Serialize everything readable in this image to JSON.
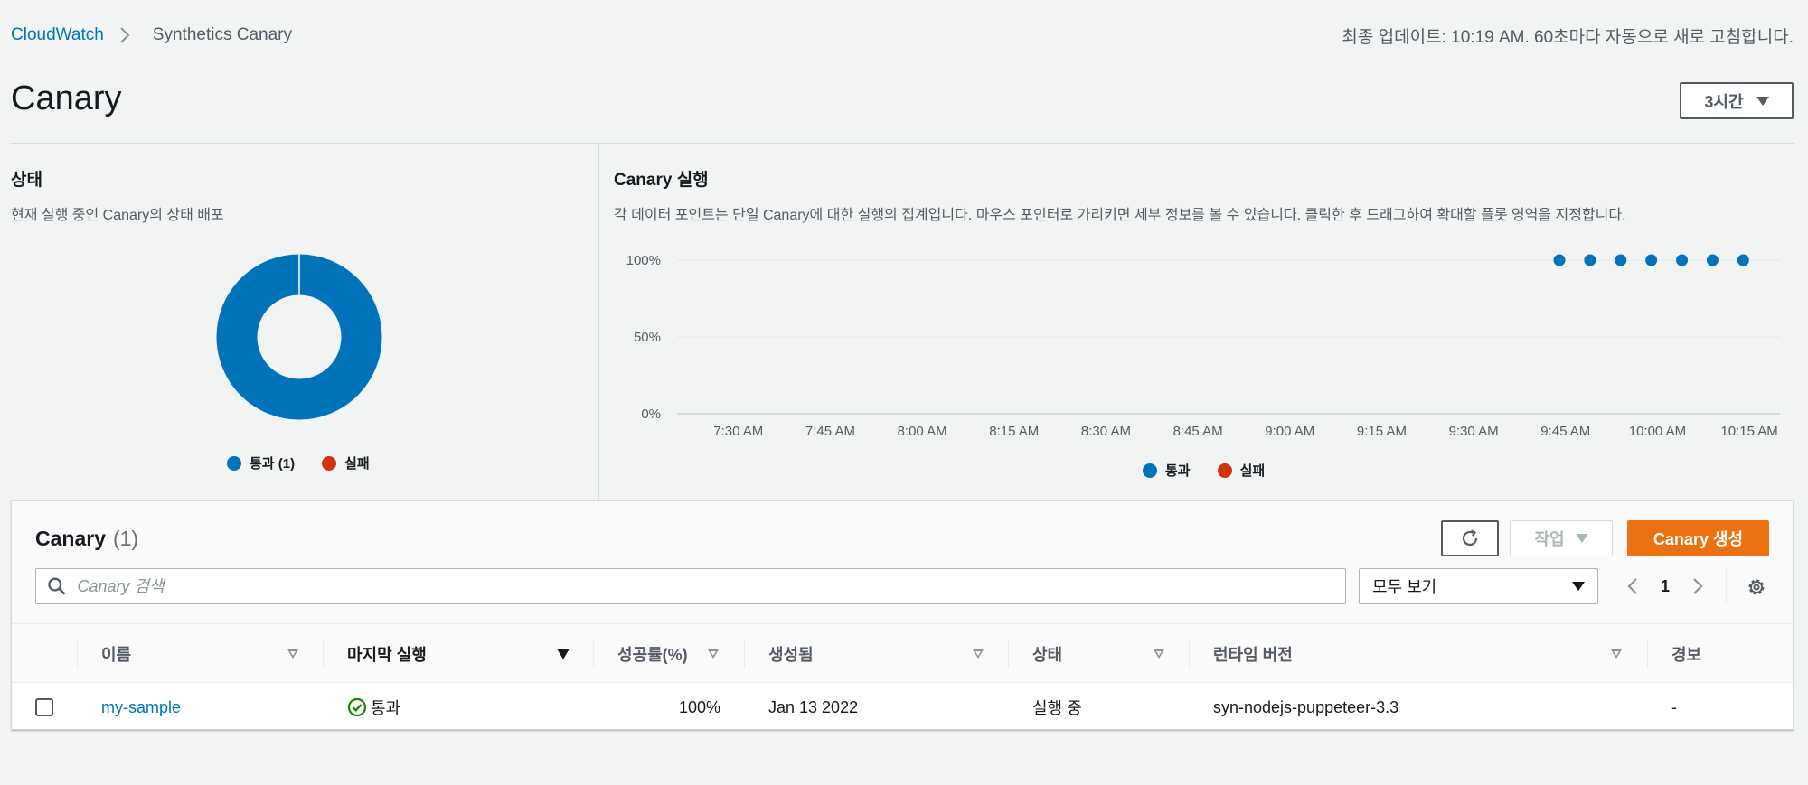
{
  "breadcrumb": {
    "root": "CloudWatch",
    "current": "Synthetics Canary"
  },
  "last_update": "최종 업데이트: 10:19 AM. 60초마다 자동으로 새로 고침합니다.",
  "page_title": "Canary",
  "time_range": "3시간",
  "status_panel": {
    "title": "상태",
    "description": "현재 실행 중인 Canary의 상태 배포",
    "legend": [
      {
        "label": "통과 (1)",
        "color": "#0073bb"
      },
      {
        "label": "실패",
        "color": "#d13212"
      }
    ]
  },
  "runs_panel": {
    "title": "Canary 실행",
    "description": "각 데이터 포인트는 단일 Canary에 대한 실행의 집계입니다. 마우스 포인터로 가리키면 세부 정보를 볼 수 있습니다. 클릭한 후 드래그하여 확대할 플롯 영역을 지정합니다.",
    "legend": [
      {
        "label": "통과",
        "color": "#0073bb"
      },
      {
        "label": "실패",
        "color": "#d13212"
      }
    ]
  },
  "chart_data": [
    {
      "type": "pie",
      "categories": [
        "통과",
        "실패"
      ],
      "values": [
        1,
        0
      ],
      "colors": [
        "#0073bb",
        "#d13212"
      ]
    },
    {
      "type": "scatter",
      "x_ticks": [
        "7:30 AM",
        "7:45 AM",
        "8:00 AM",
        "8:15 AM",
        "8:30 AM",
        "8:45 AM",
        "9:00 AM",
        "9:15 AM",
        "9:30 AM",
        "9:45 AM",
        "10:00 AM",
        "10:15 AM"
      ],
      "y_ticks": [
        "100%",
        "50%",
        "0%"
      ],
      "ylim": [
        0,
        100
      ],
      "xlim": [
        "7:20 AM",
        "10:20 AM"
      ],
      "grid": true,
      "series": [
        {
          "name": "통과",
          "color": "#0073bb",
          "points": [
            {
              "x": "9:44 AM",
              "y": 100
            },
            {
              "x": "9:49 AM",
              "y": 100
            },
            {
              "x": "9:54 AM",
              "y": 100
            },
            {
              "x": "9:59 AM",
              "y": 100
            },
            {
              "x": "10:04 AM",
              "y": 100
            },
            {
              "x": "10:09 AM",
              "y": 100
            },
            {
              "x": "10:14 AM",
              "y": 100
            }
          ]
        }
      ]
    }
  ],
  "table": {
    "title": "Canary",
    "count": "(1)",
    "actions_label": "작업",
    "create_label": "Canary 생성",
    "search_placeholder": "Canary 검색",
    "filter_value": "모두 보기",
    "page": "1",
    "columns": [
      "이름",
      "마지막 실행",
      "성공률(%)",
      "생성됨",
      "상태",
      "런타임 버전",
      "경보"
    ],
    "rows": [
      {
        "name": "my-sample",
        "last_run": "통과",
        "success_rate": "100%",
        "created": "Jan 13 2022",
        "state": "실행 중",
        "runtime": "syn-nodejs-puppeteer-3.3",
        "alarm": "-"
      }
    ]
  }
}
